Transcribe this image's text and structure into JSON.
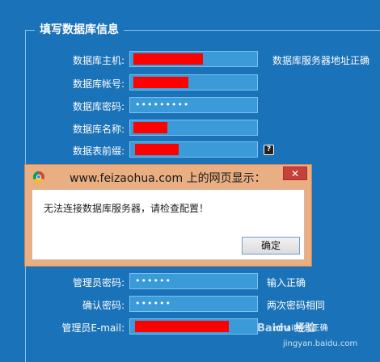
{
  "form": {
    "legend": "填写数据库信息",
    "rows": [
      {
        "label": "数据库主机:",
        "value": "",
        "hint": "数据库服务器地址正确"
      },
      {
        "label": "数据库帐号:",
        "value": "",
        "hint": ""
      },
      {
        "label": "数据库密码:",
        "value": "•••••••••",
        "hint": ""
      },
      {
        "label": "数据库名称:",
        "value": "",
        "hint": ""
      },
      {
        "label": "数据表前缀:",
        "value": "",
        "hint": "?"
      },
      {
        "label": "管理员密码:",
        "value": "••••••",
        "hint": "输入正确"
      },
      {
        "label": "确认密码:",
        "value": "••••••",
        "hint": "两次密码相同"
      },
      {
        "label": "管理员E-mail:",
        "value": "",
        "hint": "email格式正确"
      }
    ]
  },
  "dialog": {
    "title": "www.feizaohua.com 上的网页显示：",
    "close_label": "✕",
    "message": "无法连接数据库服务器，请检查配置！",
    "ok_label": "确定"
  },
  "watermark": {
    "text": "Baidu 经验",
    "url": "jingyan.baidu.com"
  },
  "colors": {
    "background": "#1a72b8",
    "field": "#3a9bd8",
    "redaction": "#ff0000"
  }
}
